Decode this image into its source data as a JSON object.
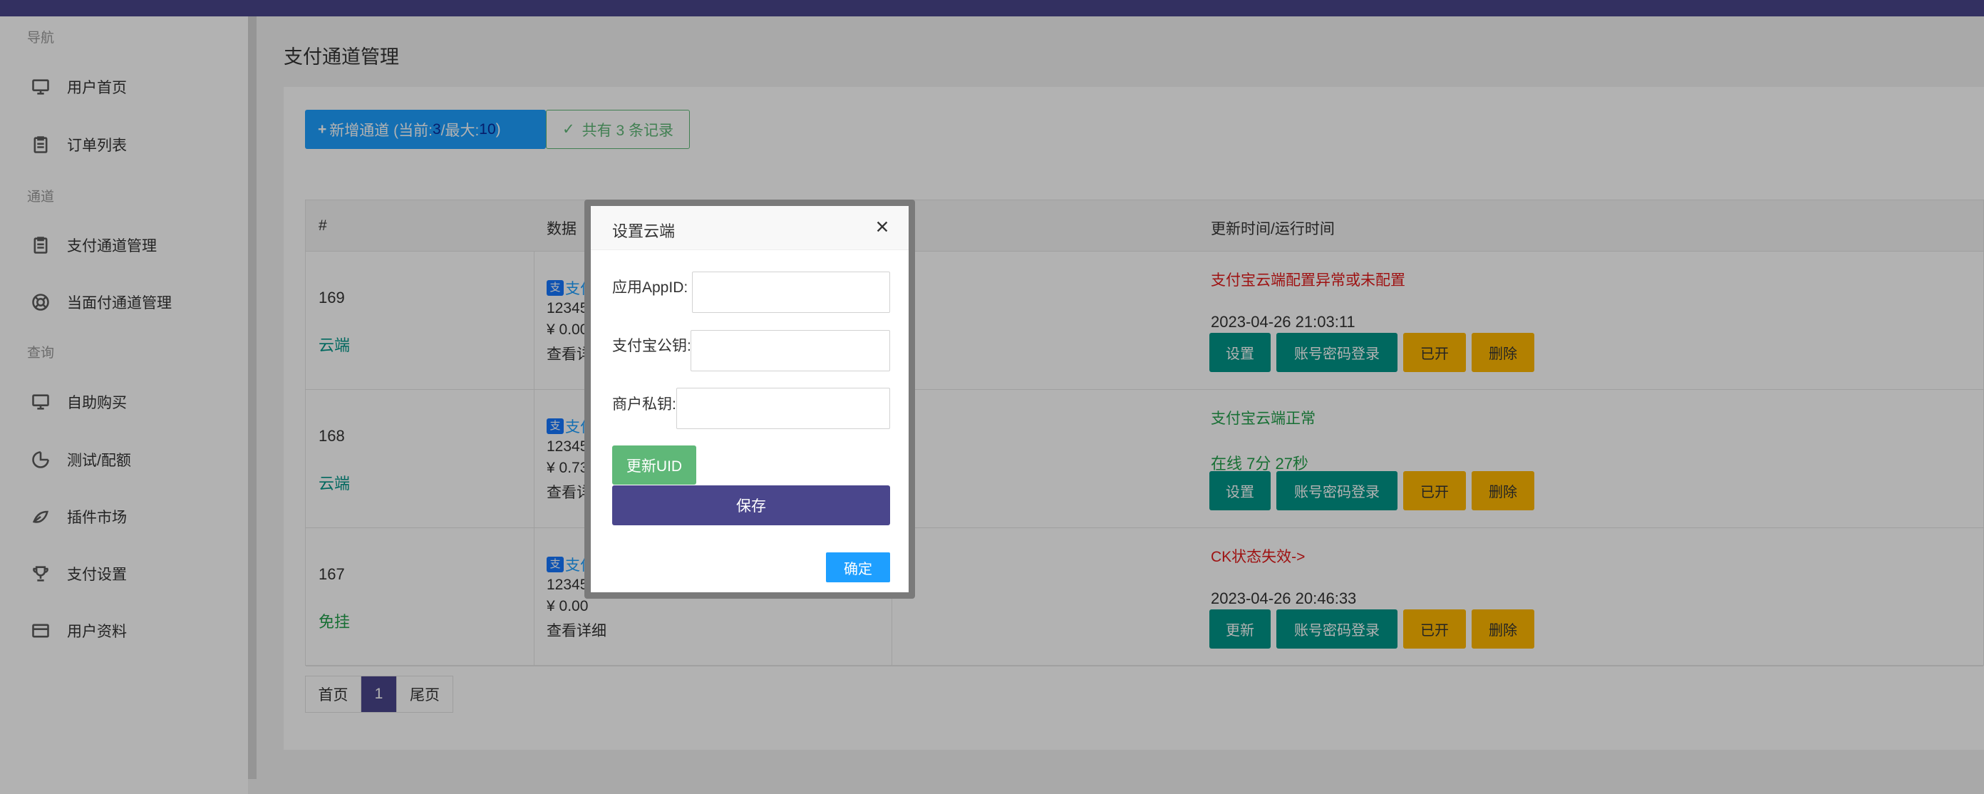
{
  "sidebar": {
    "groups": [
      "导航",
      "通道",
      "查询"
    ],
    "items": [
      {
        "label": "用户首页",
        "icon": "monitor-icon"
      },
      {
        "label": "订单列表",
        "icon": "clipboard-icon"
      },
      {
        "label": "支付通道管理",
        "icon": "clipboard-icon"
      },
      {
        "label": "当面付通道管理",
        "icon": "lifebuoy-icon"
      },
      {
        "label": "自助购买",
        "icon": "monitor-icon"
      },
      {
        "label": "测试/配额",
        "icon": "chart-dial-icon"
      },
      {
        "label": "插件市场",
        "icon": "leaf-icon"
      },
      {
        "label": "支付设置",
        "icon": "trophy-icon"
      },
      {
        "label": "用户资料",
        "icon": "card-icon"
      }
    ]
  },
  "page": {
    "title": "支付通道管理",
    "add_button": {
      "prefix": "新增通道 (当前:",
      "current": "3",
      "mid": "/最大:",
      "max": "10",
      "suffix": ")"
    },
    "count_label": "共有 3 条记录"
  },
  "table": {
    "headers": [
      "#",
      "数据",
      "更新时间/运行时间"
    ],
    "rows": [
      {
        "id": "169",
        "type": "云端",
        "ali": "支付",
        "acct": "12345",
        "money": "¥ 0.00",
        "detail": "查看详",
        "status": "支付宝云端配置异常或未配置",
        "status_kind": "err",
        "time": "2023-04-26 21:03:11",
        "btn1": "设置",
        "btn2": "账号密码登录",
        "btn3": "已开",
        "btn4": "删除"
      },
      {
        "id": "168",
        "type": "云端",
        "ali": "支付",
        "acct": "12345",
        "money": "¥ 0.73",
        "detail": "查看详",
        "status": "支付宝云端正常",
        "status_kind": "ok",
        "time": "在线 7分 27秒",
        "btn1": "设置",
        "btn2": "账号密码登录",
        "btn3": "已开",
        "btn4": "删除"
      },
      {
        "id": "167",
        "type": "免挂",
        "ali": "支付",
        "acct": "12345",
        "money": "¥ 0.00",
        "detail": "查看详细",
        "status": "CK状态失效->",
        "status_kind": "err",
        "time": "2023-04-26 20:46:33",
        "btn1": "更新",
        "btn2": "账号密码登录",
        "btn3": "已开",
        "btn4": "删除"
      }
    ]
  },
  "pager": {
    "first": "首页",
    "current": "1",
    "last": "尾页"
  },
  "modal": {
    "title": "设置云端",
    "fields": [
      {
        "label": "应用AppID:",
        "value": ""
      },
      {
        "label": "支付宝公钥:",
        "value": ""
      },
      {
        "label": "商户私钥:",
        "value": ""
      }
    ],
    "update_uid": "更新UID",
    "save": "保存",
    "confirm": "确定"
  },
  "colors": {
    "brand": "#4a468c",
    "primary": "#1e9fff",
    "success": "#009688",
    "warn": "#ffb800",
    "danger": "#e21a1a"
  }
}
